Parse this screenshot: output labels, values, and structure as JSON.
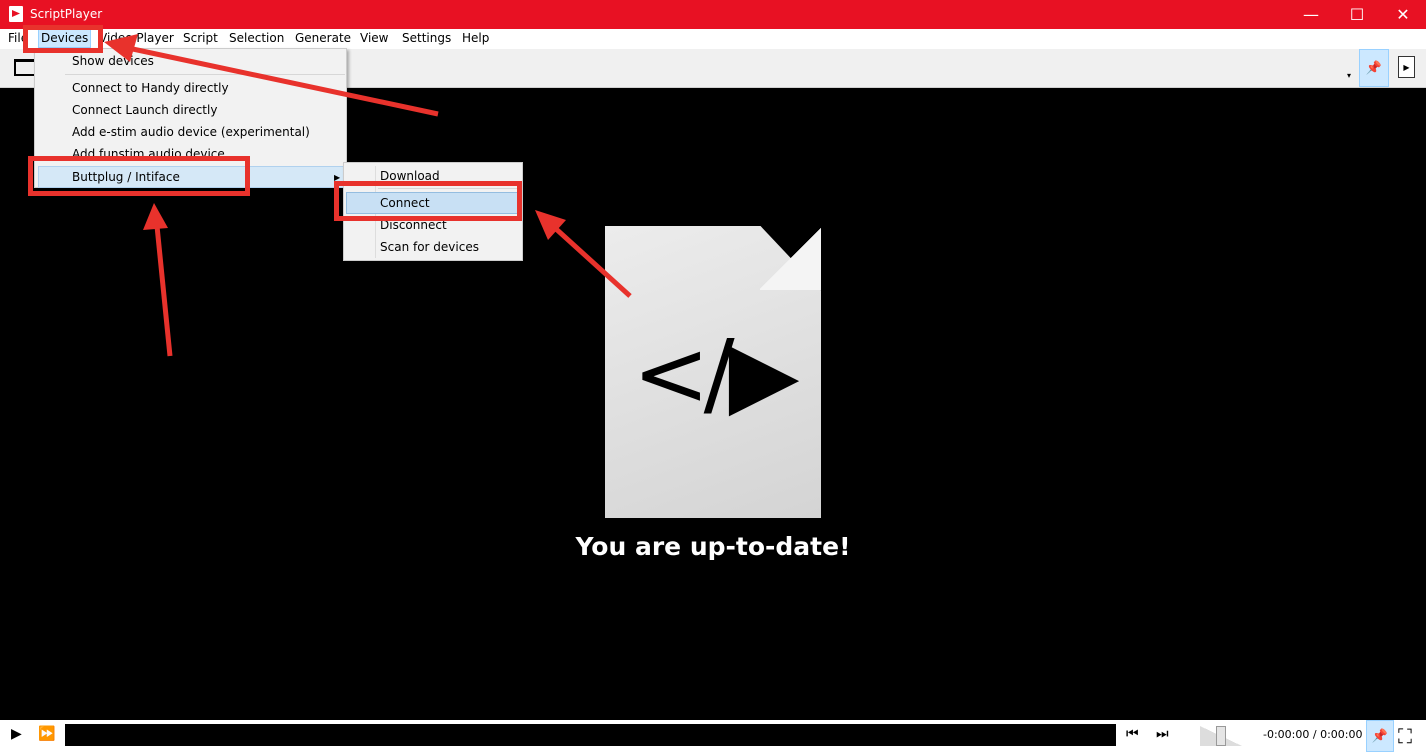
{
  "window": {
    "title": "ScriptPlayer",
    "minimize": "—",
    "maximize": "☐",
    "close": "✕"
  },
  "menubar": {
    "items": [
      "File",
      "Devices",
      "Video Player",
      "Script",
      "Selection",
      "Generate",
      "View",
      "Settings",
      "Help"
    ],
    "active": "Devices"
  },
  "devices_menu": {
    "items": [
      "Show devices",
      "Connect to Handy directly",
      "Connect Launch directly",
      "Add e-stim audio device (experimental)",
      "Add funstim audio device",
      "Buttplug / Intiface"
    ],
    "highlighted": "Buttplug / Intiface"
  },
  "buttplug_submenu": {
    "items": [
      "Download",
      "Connect",
      "Disconnect",
      "Scan for devices"
    ],
    "highlighted": "Connect"
  },
  "stage": {
    "icon_glyph": "</▶",
    "message": "You are up-to-date!"
  },
  "controls": {
    "time_display": "-0:00:00 / 0:00:00",
    "volume_fraction": 0.5
  },
  "annotation_color": "#e8322c",
  "title_bar_color": "#e81123",
  "icons": [
    "app-icon",
    "open-folder-icon",
    "pin-icon",
    "file-icon",
    "play-icon",
    "fast-forward-icon",
    "skip-previous-icon",
    "skip-next-icon",
    "fullscreen-icon",
    "submenu-arrow-icon"
  ]
}
